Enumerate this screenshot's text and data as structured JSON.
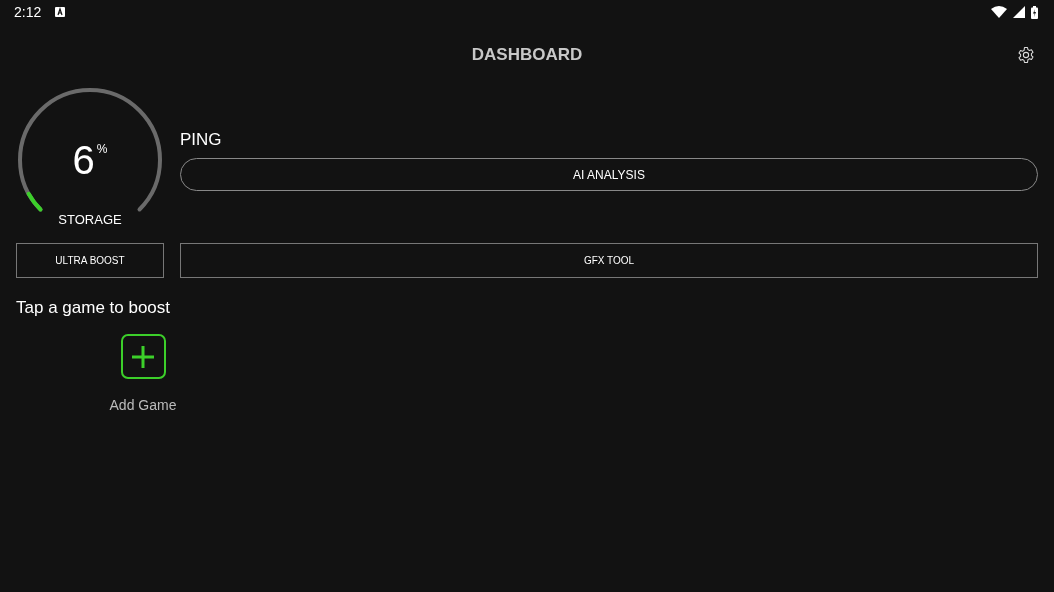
{
  "status_bar": {
    "time": "2:12"
  },
  "header": {
    "title": "DASHBOARD"
  },
  "gauge": {
    "value": "6",
    "unit": "%",
    "label": "STORAGE"
  },
  "ping": {
    "label": "PING",
    "button": "AI ANALYSIS"
  },
  "buttons": [
    "ULTRA BOOST",
    "GFX TOOL"
  ],
  "games": {
    "heading": "Tap a game to boost",
    "add_label": "Add Game"
  }
}
